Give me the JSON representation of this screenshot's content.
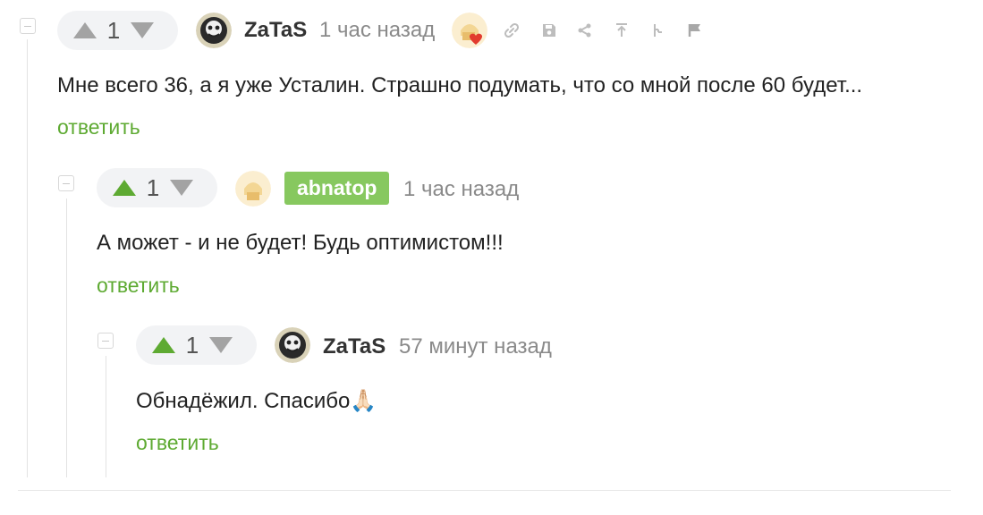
{
  "comments": [
    {
      "rating": "1",
      "author": "ZaTaS",
      "time": "1 час назад",
      "text": "Мне всего 36, а я уже Усталин. Страшно подумать, что со мной после 60 будет...",
      "reply_label": "ответить",
      "toolbar_icons": [
        "link-icon",
        "save-icon",
        "share-icon",
        "jump-to-parent-icon",
        "branch-icon",
        "report-flag-icon"
      ]
    },
    {
      "rating": "1",
      "author": "abnatop",
      "time": "1 час назад",
      "text": "А может - и не будет! Будь оптимистом!!!",
      "reply_label": "ответить"
    },
    {
      "rating": "1",
      "author": "ZaTaS",
      "time": "57 минут назад",
      "text": "Обнадёжил. Спасибо🙏🏻",
      "reply_label": "ответить"
    }
  ],
  "colors": {
    "accent_green": "#5eaa32",
    "badge_green": "#87c85f",
    "vote_bg": "#f2f3f5"
  }
}
